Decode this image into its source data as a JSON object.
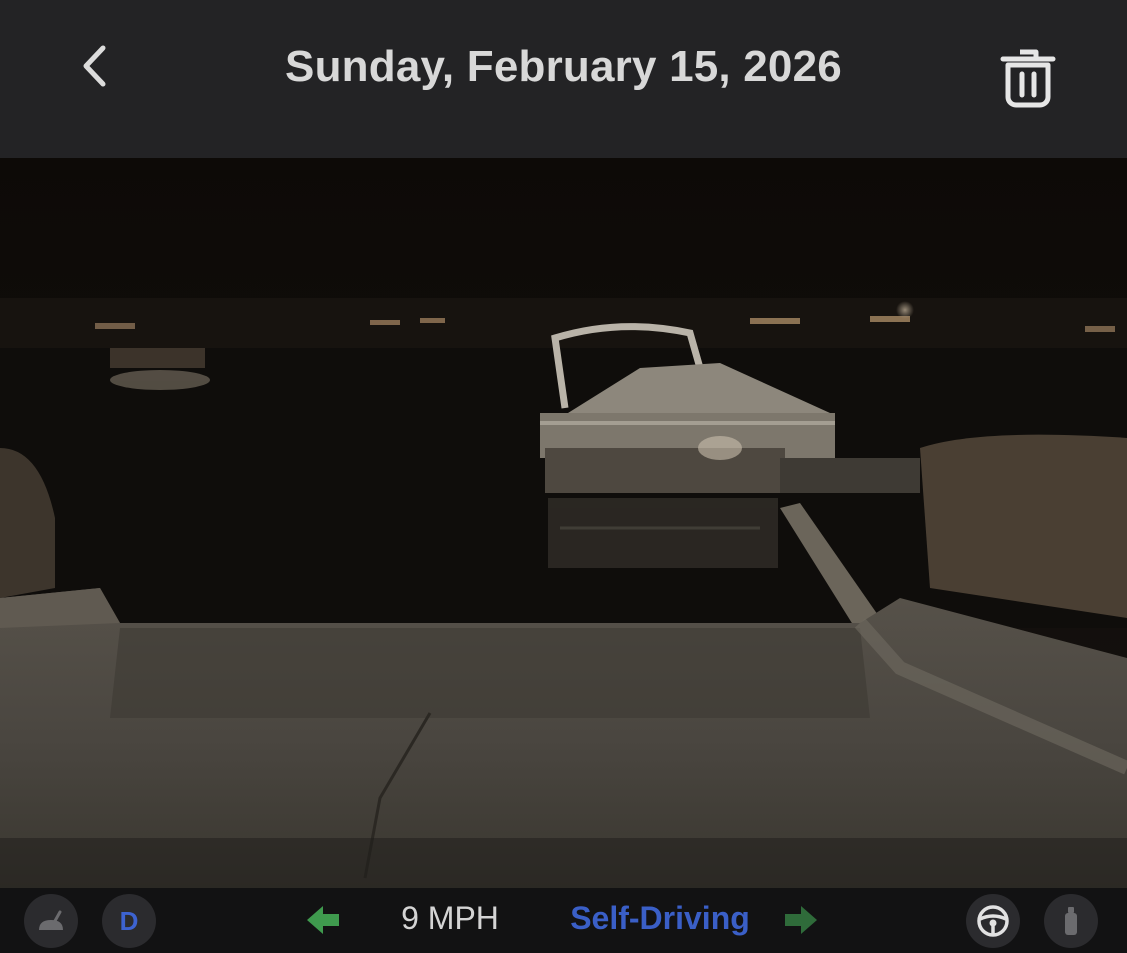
{
  "header": {
    "title": "Sunday, February 15, 2026",
    "back_icon": "chevron-left-icon",
    "trash_icon": "trash-icon"
  },
  "video": {
    "description_icon": "dashcam-video-frame"
  },
  "bottom_bar": {
    "left_icon": "wiper-icon",
    "gear": "D",
    "left_arrow_icon": "turn-signal-left-icon",
    "speed": "9 MPH",
    "mode": "Self-Driving",
    "right_arrow_icon": "turn-signal-right-icon",
    "wheel_icon": "steering-wheel-icon",
    "right_icon": "bottle-icon"
  },
  "colors": {
    "header_bg": "#232325",
    "title": "#d8d8d8",
    "gear": "#3d63d1",
    "mode": "#3a5fc7",
    "signal": "#3f9a4e"
  }
}
